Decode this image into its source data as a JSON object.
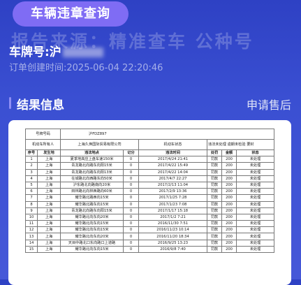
{
  "header": {
    "title_button": "车辆违章查询",
    "watermark": "报告来源：精准查车   公种号",
    "plate_label": "车牌号:沪",
    "order_time": "订单创建时间:2025-06-04 22:20:46"
  },
  "section": {
    "title": "结果信息",
    "after_sale": "申请售后"
  },
  "doc": {
    "plate_row": {
      "label": "号牌号码",
      "value": "沪FDZ897"
    },
    "owner_row": {
      "owner_label": "机动车所有人",
      "owner_value": "上海久焕国际贸易有限公司",
      "status_label": "机动车状态",
      "status_value": "违法未处理 逾期未检验 要封"
    },
    "columns": [
      "序号",
      "发生地",
      "违法地点",
      "记分",
      "违法时间",
      "处罚",
      "金额",
      "状态"
    ],
    "rows": [
      [
        "1",
        "上海",
        "夏季地高应上盘车速150米",
        "0",
        "2017/4/24 21:41",
        "罚款",
        "200",
        "未处理"
      ],
      [
        "2",
        "上海",
        "青龙路北向路东向阳15米",
        "0",
        "2017/4/22 15:49",
        "罚款",
        "200",
        "未处理"
      ],
      [
        "3",
        "上海",
        "青龙路北向路东向阳13米",
        "0",
        "2017/4/22 14:04",
        "罚款",
        "200",
        "未处理"
      ],
      [
        "4",
        "上海",
        "在城路北向西路东向50米",
        "0",
        "2017/4/7 22:27",
        "罚款",
        "200",
        "未处理"
      ],
      [
        "5",
        "上海",
        "沪东路北向路南向20米",
        "0",
        "2017/2/13 11:04",
        "罚款",
        "200",
        "未处理"
      ],
      [
        "6",
        "上海",
        "田林路北向林西路向60米",
        "0",
        "2017/2/9 13:36",
        "罚款",
        "200",
        "未处理"
      ],
      [
        "7",
        "上海",
        "耀华路北路西向15米",
        "0",
        "2017/1/25 7:28",
        "罚款",
        "200",
        "未处理"
      ],
      [
        "8",
        "上海",
        "耀华路北路东向15米",
        "0",
        "2017/1/23 7:08",
        "罚款",
        "200",
        "未处理"
      ],
      [
        "9",
        "上海",
        "青龙路北向路东向阳15米",
        "0",
        "2017/1/17 15:18",
        "罚款",
        "200",
        "未处理"
      ],
      [
        "10",
        "上海",
        "耀华路北向东向20米",
        "0",
        "2017/1/2 7:21",
        "罚款",
        "200",
        "未处理"
      ],
      [
        "11",
        "上海",
        "耀华路北向东向15米",
        "0",
        "2016/11/30 7:51",
        "罚款",
        "200",
        "未处理"
      ],
      [
        "12",
        "上海",
        "耀华路北向东向15米",
        "0",
        "2016/11/23 10:14",
        "罚款",
        "200",
        "未处理"
      ],
      [
        "13",
        "上海",
        "耀华路北向东向20米",
        "0",
        "2016/11/20 18:34",
        "罚款",
        "200",
        "未处理"
      ],
      [
        "14",
        "上海",
        "天目中路北口东向路口上道路",
        "0",
        "2016/9/25 13:23",
        "罚款",
        "200",
        "未处理"
      ],
      [
        "15",
        "上海",
        "耀华路北向东向15米",
        "0",
        "2016/9/8 7:40",
        "罚款",
        "200",
        "未处理"
      ]
    ]
  }
}
